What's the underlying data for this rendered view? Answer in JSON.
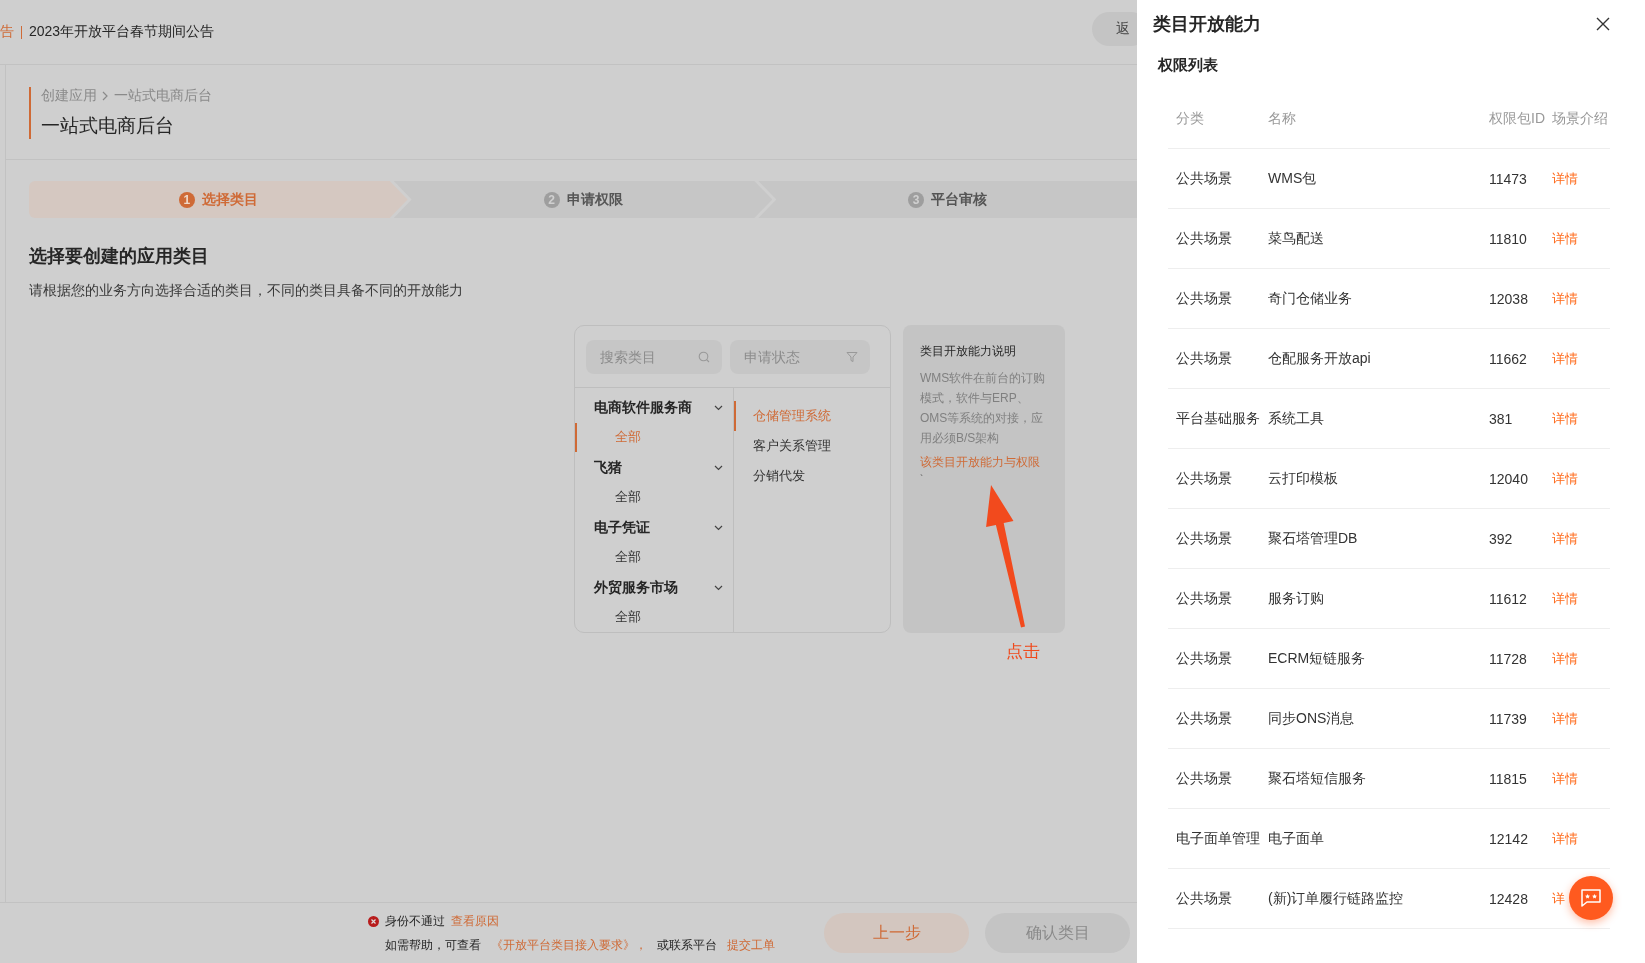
{
  "announcement": {
    "tag": "告",
    "text": "2023年开放平台春节期间公告",
    "back_button": "返"
  },
  "breadcrumb": [
    "创建应用",
    "一站式电商后台"
  ],
  "page_title": "一站式电商后台",
  "steps": [
    {
      "number": "1",
      "label": "选择类目",
      "selected": true
    },
    {
      "number": "2",
      "label": "申请权限",
      "selected": false
    },
    {
      "number": "3",
      "label": "平台审核",
      "selected": false
    }
  ],
  "section": {
    "heading": "选择要创建的应用类目",
    "description": "请根据您的业务方向选择合适的类目，不同的类目具备不同的开放能力"
  },
  "category_picker": {
    "search": {
      "placeholder": "搜索类目"
    },
    "status_filter": {
      "placeholder": "申请状态"
    },
    "groups": [
      {
        "label": "电商软件服务商",
        "children": [
          {
            "label": "全部",
            "selected": true
          }
        ]
      },
      {
        "label": "飞猪",
        "children": [
          {
            "label": "全部",
            "selected": false
          }
        ]
      },
      {
        "label": "电子凭证",
        "children": [
          {
            "label": "全部",
            "selected": false
          }
        ]
      },
      {
        "label": "外贸服务市场",
        "children": [
          {
            "label": "全部",
            "selected": false
          }
        ]
      }
    ],
    "subcategories": [
      {
        "label": "仓储管理系统",
        "selected": true
      },
      {
        "label": "客户关系管理",
        "selected": false
      },
      {
        "label": "分销代发",
        "selected": false
      }
    ]
  },
  "info_card": {
    "title": "类目开放能力说明",
    "description": "WMS软件在前台的订购模式，软件与ERP、OMS等系统的对接，应用必须B/S架构",
    "link": "该类目开放能力与权限",
    "mark": "`"
  },
  "annotation": {
    "label": "点击"
  },
  "footer": {
    "status": "身份不通过",
    "status_link": "查看原因",
    "help_prefix": "如需帮助，可查看",
    "help_link": "《开放平台类目接入要求》，",
    "help_middle": "或联系平台",
    "help_link2": "提交工单",
    "buttons": [
      {
        "label": "上一步",
        "kind": "secondary"
      },
      {
        "label": "确认类目",
        "kind": "disabled"
      }
    ]
  },
  "drawer": {
    "title": "类目开放能力",
    "section": "权限列表",
    "table": {
      "columns": [
        "分类",
        "名称",
        "权限包ID",
        "场景介绍"
      ],
      "rows": [
        {
          "category": "公共场景",
          "name": "WMS包",
          "id": "11473",
          "detail": "详情"
        },
        {
          "category": "公共场景",
          "name": "菜鸟配送",
          "id": "11810",
          "detail": "详情"
        },
        {
          "category": "公共场景",
          "name": "奇门仓储业务",
          "id": "12038",
          "detail": "详情"
        },
        {
          "category": "公共场景",
          "name": "仓配服务开放api",
          "id": "11662",
          "detail": "详情"
        },
        {
          "category": "平台基础服务",
          "name": "系统工具",
          "id": "381",
          "detail": "详情"
        },
        {
          "category": "公共场景",
          "name": "云打印模板",
          "id": "12040",
          "detail": "详情"
        },
        {
          "category": "公共场景",
          "name": "聚石塔管理DB",
          "id": "392",
          "detail": "详情"
        },
        {
          "category": "公共场景",
          "name": "服务订购",
          "id": "11612",
          "detail": "详情"
        },
        {
          "category": "公共场景",
          "name": "ECRM短链服务",
          "id": "11728",
          "detail": "详情"
        },
        {
          "category": "公共场景",
          "name": "同步ONS消息",
          "id": "11739",
          "detail": "详情"
        },
        {
          "category": "公共场景",
          "name": "聚石塔短信服务",
          "id": "11815",
          "detail": "详情"
        },
        {
          "category": "电子面单管理",
          "name": "电子面单",
          "id": "12142",
          "detail": "详情"
        },
        {
          "category": "公共场景",
          "name": "(新)订单履行链路监控",
          "id": "12428",
          "detail": "详"
        }
      ]
    }
  }
}
